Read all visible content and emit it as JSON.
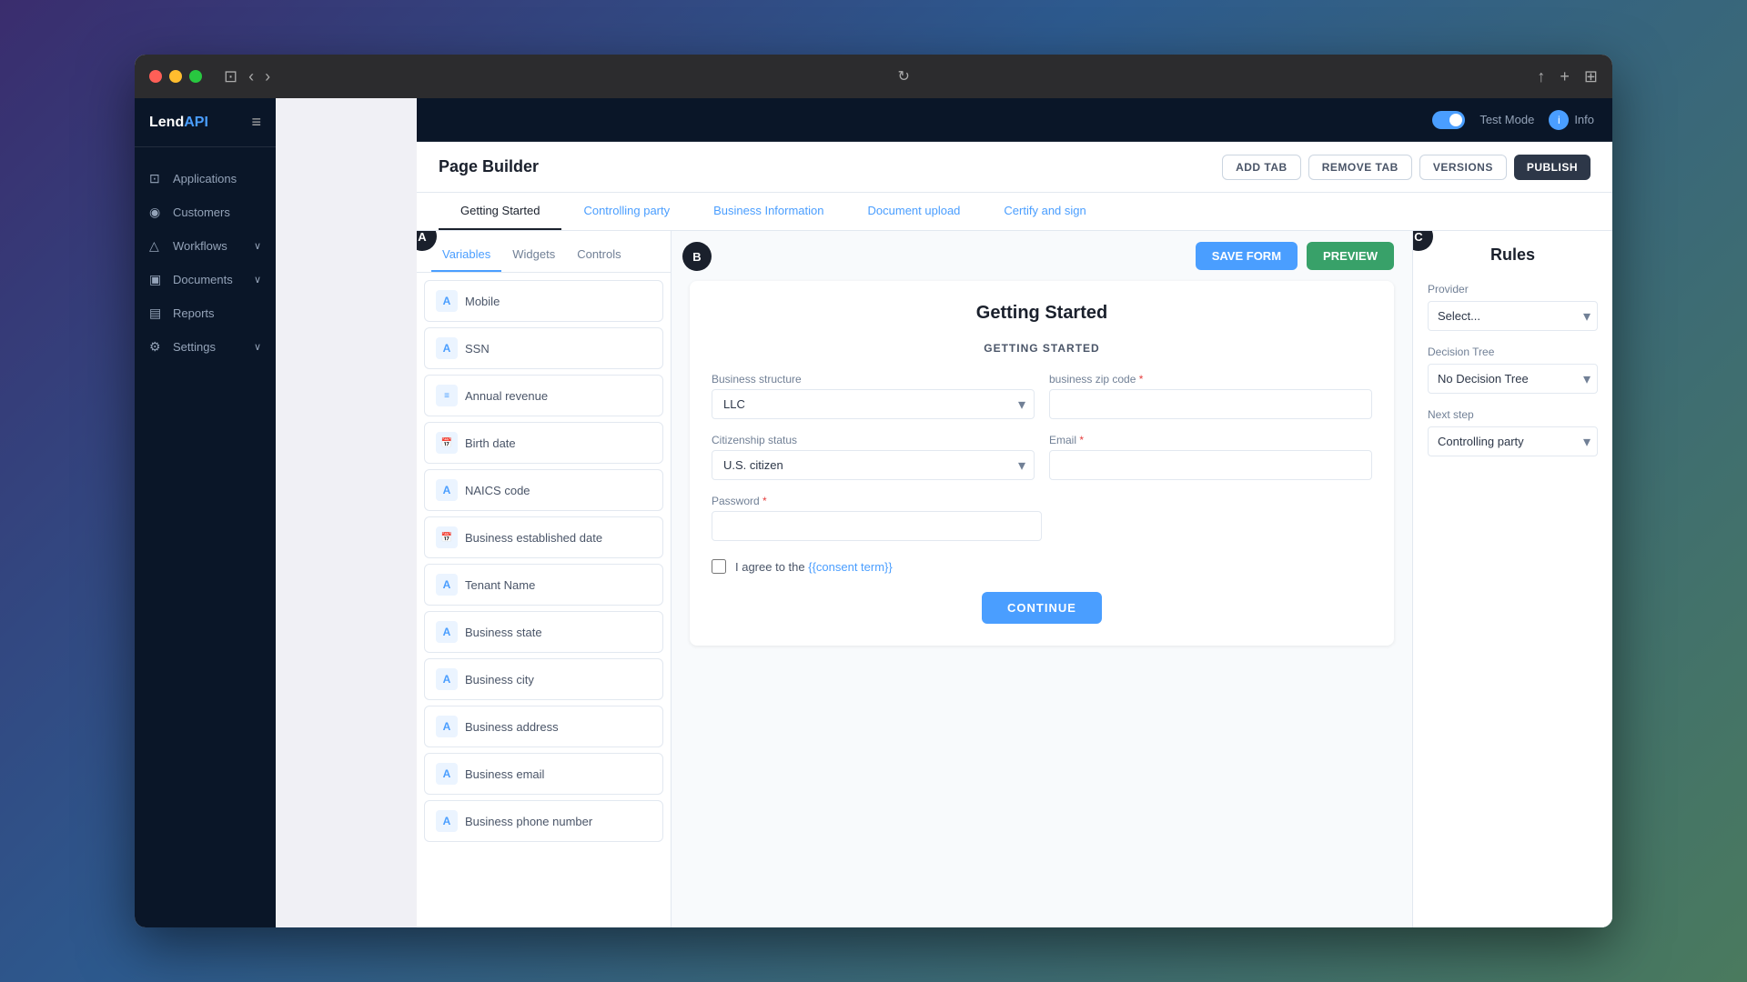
{
  "browser": {
    "reload_icon": "↻",
    "back_icon": "‹",
    "forward_icon": "›",
    "sidebar_icon": "⊡",
    "share_icon": "↑",
    "new_tab_icon": "+",
    "grid_icon": "⊞"
  },
  "topbar": {
    "logo": "LendAPI",
    "logo_brand": "Lend",
    "logo_accent": "API",
    "menu_icon": "≡",
    "toggle_label": "Test Mode",
    "info_label": "Info"
  },
  "sidebar": {
    "items": [
      {
        "id": "applications",
        "label": "Applications",
        "icon": "□",
        "has_arrow": false
      },
      {
        "id": "customers",
        "label": "Customers",
        "icon": "👤",
        "has_arrow": false
      },
      {
        "id": "workflows",
        "label": "Workflows",
        "icon": "△",
        "has_arrow": true
      },
      {
        "id": "documents",
        "label": "Documents",
        "icon": "□",
        "has_arrow": true
      },
      {
        "id": "reports",
        "label": "Reports",
        "icon": "□",
        "has_arrow": false
      },
      {
        "id": "settings",
        "label": "Settings",
        "icon": "⚙",
        "has_arrow": true
      }
    ]
  },
  "page_builder": {
    "title": "Page Builder",
    "buttons": {
      "add_tab": "ADD TAB",
      "remove_tab": "REMOVE TAB",
      "versions": "VERSIONS",
      "publish": "PUBLISH"
    },
    "tabs": [
      {
        "id": "getting-started",
        "label": "Getting Started",
        "active": true
      },
      {
        "id": "controlling-party",
        "label": "Controlling party",
        "active": false
      },
      {
        "id": "business-information",
        "label": "Business Information",
        "active": false
      },
      {
        "id": "document-upload",
        "label": "Document upload",
        "active": false
      },
      {
        "id": "certify-sign",
        "label": "Certify and sign",
        "active": false
      }
    ]
  },
  "panel_a": {
    "label": "A",
    "tabs": [
      {
        "id": "variables",
        "label": "Variables",
        "active": true
      },
      {
        "id": "widgets",
        "label": "Widgets",
        "active": false
      },
      {
        "id": "controls",
        "label": "Controls",
        "active": false
      }
    ],
    "variables": [
      {
        "id": "mobile",
        "icon": "A",
        "icon_type": "text",
        "label": "Mobile"
      },
      {
        "id": "ssn",
        "icon": "A",
        "icon_type": "text",
        "label": "SSN"
      },
      {
        "id": "annual-revenue",
        "icon": "≡",
        "icon_type": "list",
        "label": "Annual revenue"
      },
      {
        "id": "birth-date",
        "icon": "📅",
        "icon_type": "calendar",
        "label": "Birth date"
      },
      {
        "id": "naics-code",
        "icon": "A",
        "icon_type": "text",
        "label": "NAICS code"
      },
      {
        "id": "business-established-date",
        "icon": "📅",
        "icon_type": "calendar",
        "label": "Business established date"
      },
      {
        "id": "tenant-name",
        "icon": "A",
        "icon_type": "text",
        "label": "Tenant Name"
      },
      {
        "id": "business-state",
        "icon": "A",
        "icon_type": "text",
        "label": "Business state"
      },
      {
        "id": "business-city",
        "icon": "A",
        "icon_type": "text",
        "label": "Business city"
      },
      {
        "id": "business-address",
        "icon": "A",
        "icon_type": "text",
        "label": "Business address"
      },
      {
        "id": "business-email",
        "icon": "A",
        "icon_type": "text",
        "label": "Business email"
      },
      {
        "id": "business-phone-number",
        "icon": "A",
        "icon_type": "text",
        "label": "Business phone number"
      }
    ]
  },
  "panel_b": {
    "label": "B",
    "save_form_label": "SAVE FORM",
    "preview_label": "PREVIEW",
    "form": {
      "title": "Getting Started",
      "subtitle": "GETTING STARTED",
      "fields": {
        "business_structure": {
          "label": "Business structure",
          "value": "LLC",
          "type": "select"
        },
        "business_zip_code": {
          "label": "business zip code",
          "required": true,
          "value": "",
          "type": "input"
        },
        "citizenship_status": {
          "label": "Citizenship status",
          "value": "U.S. citizen",
          "type": "select"
        },
        "email": {
          "label": "Email",
          "required": true,
          "value": "",
          "type": "input"
        },
        "password": {
          "label": "Password",
          "required": true,
          "value": "",
          "type": "input"
        }
      },
      "consent": {
        "text": "I agree to the {{consent term}}",
        "link_text": "{{consent term}}"
      },
      "continue_button": "CONTINUE"
    }
  },
  "panel_c": {
    "label": "C",
    "title": "Rules",
    "provider": {
      "label": "Provider",
      "placeholder": "Select...",
      "value": ""
    },
    "decision_tree": {
      "label": "Decision Tree",
      "value": "No Decision Tree",
      "options": [
        "No Decision Tree"
      ]
    },
    "next_step": {
      "label": "Next step",
      "value": "Controlling party",
      "options": [
        "Controlling party"
      ]
    }
  }
}
